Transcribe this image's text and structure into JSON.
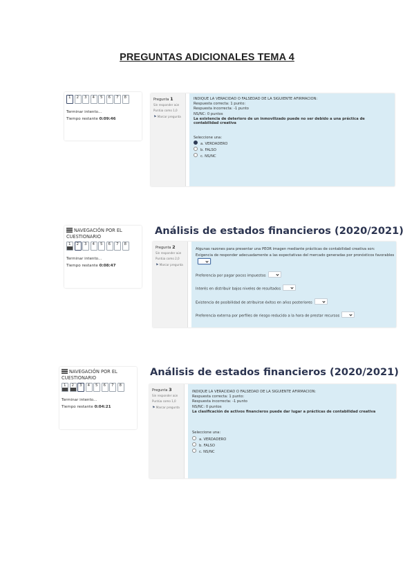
{
  "title": "PREGUNTAS ADICIONALES TEMA 4",
  "screenshots": [
    {
      "nav": {
        "heading": "",
        "boxes": [
          {
            "num": "1",
            "state": "current"
          },
          {
            "num": "2",
            "state": "plain"
          },
          {
            "num": "3",
            "state": "plain"
          },
          {
            "num": "4",
            "state": "plain"
          },
          {
            "num": "5",
            "state": "plain"
          },
          {
            "num": "6",
            "state": "plain"
          },
          {
            "num": "7",
            "state": "plain"
          },
          {
            "num": "8",
            "state": "plain"
          }
        ],
        "finish": "Terminar intento...",
        "timer_label": "Tiempo restante",
        "timer_value": "0:09:46"
      },
      "course_title": "",
      "question": {
        "label": "Pregunta",
        "number": "1",
        "status": "Sin responder aún",
        "score": "Puntúa como 1,0",
        "flag": "Marcar pregunta",
        "lines": [
          "INDIQUE LA VERACIDAD O FALSEDAD DE LA SIGUIENTE AFIRMACION:",
          "Respuesta correcta: 1 punto:",
          "Respuesta incorrecta: -1 punto",
          "NS/NC: 0 puntos"
        ],
        "statement": "La existencia de deterioro de un inmovilizado puede no ser debido a una práctica de contabilidad creativa",
        "prompt": "Seleccione una:",
        "options": [
          {
            "label": "a. VERDADERO",
            "selected": true
          },
          {
            "label": "b. FALSO",
            "selected": false
          },
          {
            "label": "c. NS/NC",
            "selected": false
          }
        ]
      }
    },
    {
      "nav": {
        "heading": "NAVEGACIÓN POR EL CUESTIONARIO",
        "boxes": [
          {
            "num": "1",
            "state": "answered"
          },
          {
            "num": "2",
            "state": "current"
          },
          {
            "num": "3",
            "state": "plain"
          },
          {
            "num": "4",
            "state": "plain"
          },
          {
            "num": "5",
            "state": "plain"
          },
          {
            "num": "6",
            "state": "plain"
          },
          {
            "num": "7",
            "state": "plain"
          },
          {
            "num": "8",
            "state": "plain"
          }
        ],
        "finish": "Terminar intento...",
        "timer_label": "Tiempo restante",
        "timer_value": "0:08:47"
      },
      "course_title": "Análisis de estados financieros (2020/2021)",
      "question": {
        "label": "Pregunta",
        "number": "2",
        "status": "Sin responder aún",
        "score": "Puntúa como 2,0",
        "flag": "Marcar pregunta",
        "intro": "Algunas razones para presentar una PEOR imagen mediante prácticas de contabilidad creativa son:",
        "rows": [
          "Exigencia de responder adecuadamente a las expectativas del mercado generadas por pronósticos favorables",
          "Preferencia por pagar pocos impuestos",
          "Interés en distribuir bajos niveles de resultados",
          "Existencia de posibilidad de atribuirse éxitos en años posteriores",
          "Preferencia externa por perfiles de riesgo reducido a la hora de prestar recursos"
        ]
      }
    },
    {
      "nav": {
        "heading": "NAVEGACIÓN POR EL CUESTIONARIO",
        "boxes": [
          {
            "num": "1",
            "state": "answered"
          },
          {
            "num": "2",
            "state": "answered"
          },
          {
            "num": "3",
            "state": "current"
          },
          {
            "num": "4",
            "state": "plain"
          },
          {
            "num": "5",
            "state": "plain"
          },
          {
            "num": "6",
            "state": "plain"
          },
          {
            "num": "7",
            "state": "plain"
          },
          {
            "num": "8",
            "state": "plain"
          }
        ],
        "finish": "Terminar intento...",
        "timer_label": "Tiempo restante",
        "timer_value": "0:04:21"
      },
      "course_title": "Análisis de estados financieros (2020/2021)",
      "question": {
        "label": "Pregunta",
        "number": "3",
        "status": "Sin responder aún",
        "score": "Puntúa como 1,0",
        "flag": "Marcar pregunta",
        "lines": [
          "INDIQUE LA VERACIDAD O FALSEDAD DE LA SIGUIENTE AFIRMACION:",
          "Respuesta correcta: 1 punto:",
          "Respuesta incorrecta: -1 punto",
          "NS/NC: 0 puntos"
        ],
        "statement": "La clasificación de activos financieros puede dar lugar a prácticas de contabilidad creativa",
        "prompt": "Seleccione una:",
        "options": [
          {
            "label": "a. VERDADERO",
            "selected": false
          },
          {
            "label": "b. FALSO",
            "selected": false
          },
          {
            "label": "c. NS/NC",
            "selected": false
          }
        ]
      }
    }
  ]
}
